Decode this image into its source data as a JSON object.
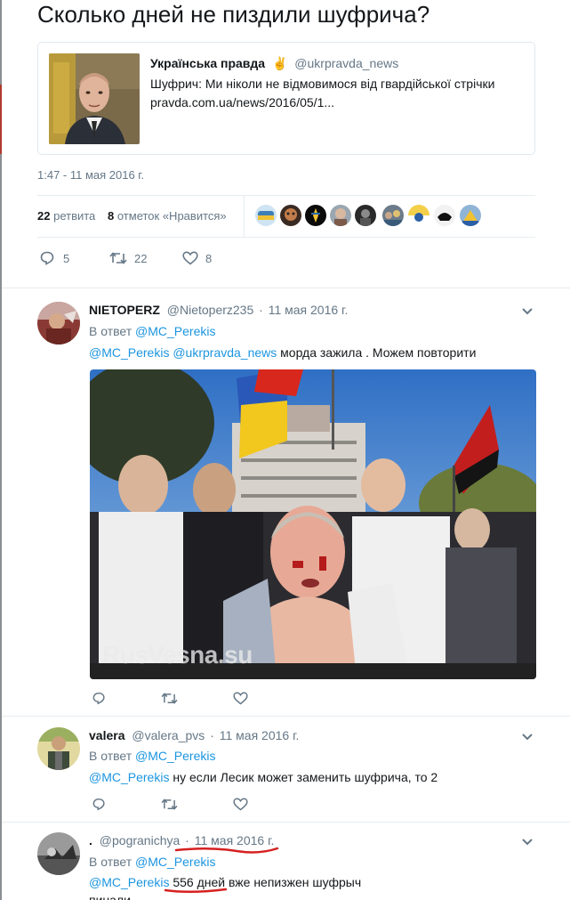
{
  "tweet": {
    "text": "Сколько дней не пиздили шуфрича?",
    "timestamp": "1:47 - 11 мая 2016 г.",
    "retweets_count": "22",
    "retweets_label": "ретвита",
    "likes_count": "8",
    "likes_label": "отметок «Нравится»",
    "reply_count": "5",
    "retweet_count": "22",
    "like_count": "8"
  },
  "quote": {
    "name": "Українська правда",
    "emoji": "✌",
    "handle": "@ukrpravda_news",
    "text": "Шуфрич: Ми ніколи не відмовимося від гвардійської стрічки",
    "link": "pravda.com.ua/news/2016/05/1..."
  },
  "likers": [
    "flag-avatar",
    "skull-avatar",
    "trident-avatar",
    "face-avatar",
    "dark-avatar",
    "crowd-avatar",
    "ukraine-avatar",
    "eagle-avatar",
    "flag2-avatar"
  ],
  "replies": [
    {
      "name": "NIETOPERZ",
      "handle": "@Nietoperz235",
      "sep": "·",
      "date": "11 мая 2016 г.",
      "reply_prefix": "В ответ",
      "reply_to": "@MC_Perekis",
      "mention1": "@MC_Perekis",
      "mention2": "@ukrpravda_news",
      "text": "морда зажила . Можем повторити",
      "watermark": "RusVesna.su"
    },
    {
      "name": "valera",
      "handle": "@valera_pvs",
      "sep": "·",
      "date": "11 мая 2016 г.",
      "reply_prefix": "В ответ",
      "reply_to": "@MC_Perekis",
      "mention1": "@MC_Perekis",
      "text": "ну если Лесик может заменить шуфрича, то 2"
    },
    {
      "name": ".",
      "handle": "@pogranichya",
      "sep": "·",
      "date": "11 мая 2016 г.",
      "reply_prefix": "В ответ",
      "reply_to": "@MC_Perekis",
      "mention1": "@MC_Perekis",
      "text_highlight": "556 дней",
      "text": "вже непизжен шуфрыч",
      "text_line2": "пинали"
    }
  ],
  "colors": {
    "accent": "#1b95e0",
    "text": "#14171a",
    "muted": "#657786",
    "annotation": "#d62020"
  }
}
